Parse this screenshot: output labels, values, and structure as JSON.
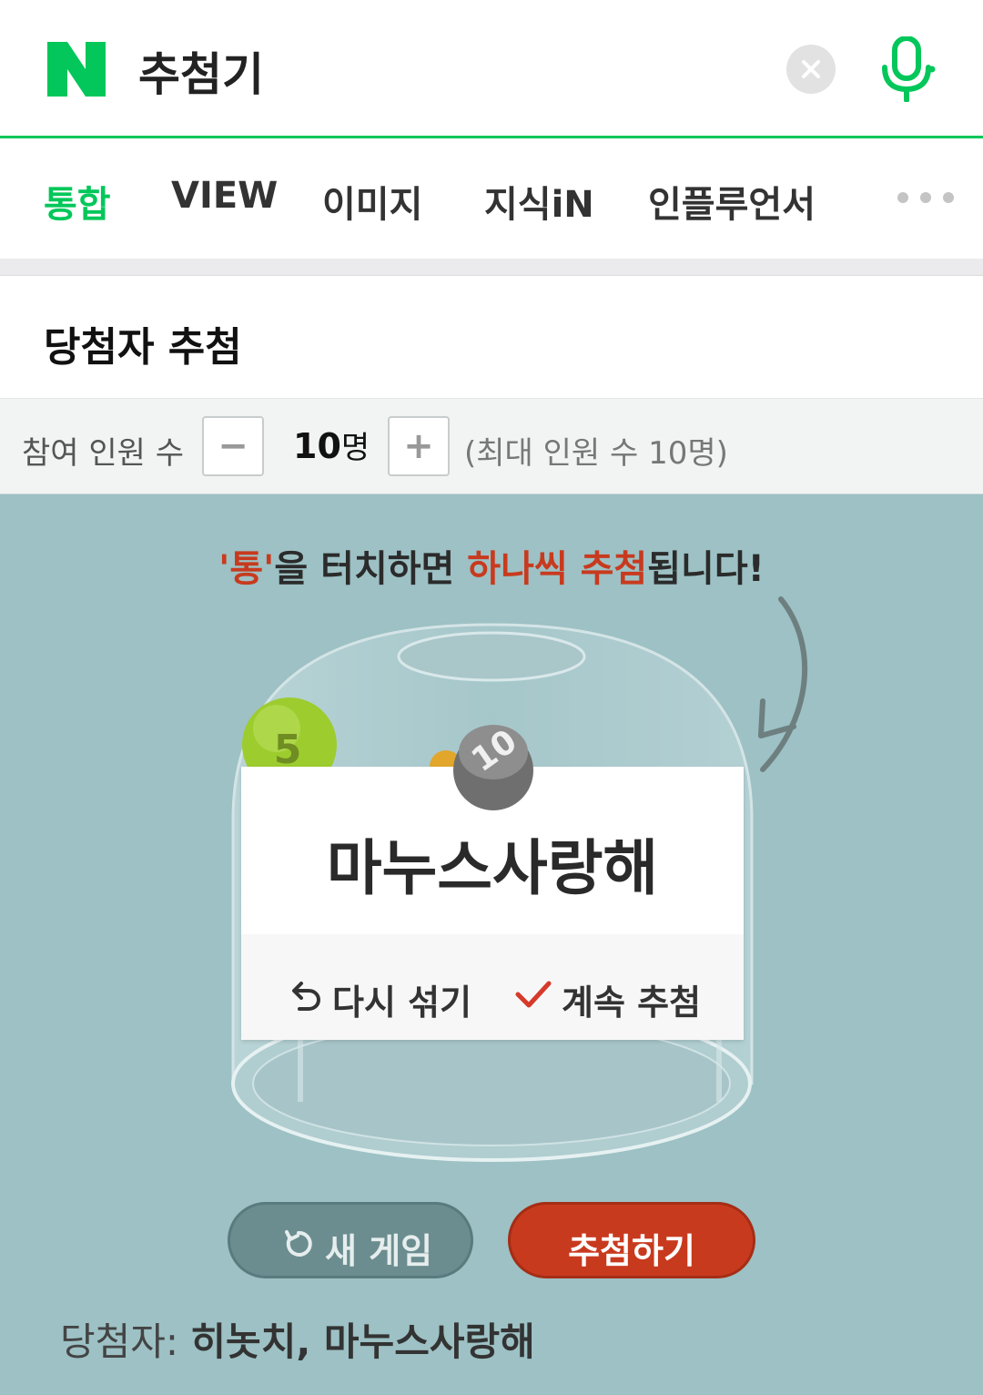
{
  "search": {
    "query": "추첨기"
  },
  "tabs": [
    "통합",
    "VIEW",
    "이미지",
    "지식iN",
    "인플루언서"
  ],
  "card": {
    "title": "당첨자 추첨"
  },
  "participants": {
    "label": "참여 인원 수",
    "count": "10",
    "unit": "명",
    "max_note": "(최대 인원 수 10명)"
  },
  "instruction": {
    "part1": "'통'",
    "part2": "을 터치하면 ",
    "part3": "하나씩 추첨",
    "part4": "됩니다!"
  },
  "balls": {
    "green": "5",
    "gray": "10"
  },
  "result": {
    "name": "마누스사랑해",
    "reshuffle": "다시 섞기",
    "continue": "계속 추첨"
  },
  "buttons": {
    "new_game": "새 게임",
    "draw": "추첨하기"
  },
  "winners": {
    "label": "당첨자: ",
    "names": "히놋치, 마누스사랑해"
  },
  "colors": {
    "brand": "#03c75a",
    "accent": "#c83a1e",
    "background": "#9dc1c4"
  }
}
